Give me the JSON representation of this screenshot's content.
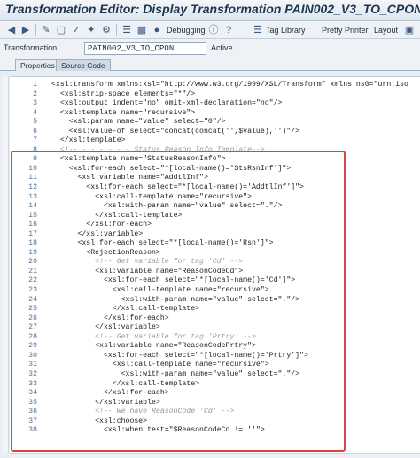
{
  "window": {
    "title": "Transformation Editor: Display Transformation PAIN002_V3_TO_CPON"
  },
  "toolbar": {
    "debugging_label": "Debugging",
    "tag_library_label": "Tag Library",
    "pretty_printer_label": "Pretty Printer",
    "layout_label": "Layout"
  },
  "transformation_field": {
    "label": "Transformation",
    "value": "PAIN002_V3_TO_CPON",
    "status": "Active"
  },
  "tabs": [
    {
      "label": "Properties",
      "active": false
    },
    {
      "label": "Source Code",
      "active": true
    }
  ],
  "editor": {
    "highlight_color": "#d64545",
    "lines": [
      {
        "no": "1",
        "text": "<xsl:transform xmlns:xsl=\"http://www.w3.org/1999/XSL/Transform\" xmlns:ns0=\"urn:iso",
        "comment": false
      },
      {
        "no": "2",
        "text": "  <xsl:strip-space elements=\"*\"/>",
        "comment": false
      },
      {
        "no": "3",
        "text": "  <xsl:output indent=\"no\" omit-xml-declaration=\"no\"/>",
        "comment": false
      },
      {
        "no": "4",
        "text": "  <xsl:template name=\"recursive\">",
        "comment": false
      },
      {
        "no": "5",
        "text": "    <xsl:param name=\"value\" select=\"0\"/>",
        "comment": false
      },
      {
        "no": "6",
        "text": "    <xsl:value-of select=\"concat(concat('',$value),'')\"/>",
        "comment": false
      },
      {
        "no": "7",
        "text": "  </xsl:template>",
        "comment": false
      },
      {
        "no": "8",
        "text": "  <!-- - - - - - - Status Reason Info Template-->",
        "comment": true
      },
      {
        "no": "9",
        "text": "  <xsl:template name=\"StatusReasonInfo\">",
        "comment": false
      },
      {
        "no": "10",
        "text": "    <xsl:for-each select=\"*[local-name()='StsRsnInf']\">",
        "comment": false
      },
      {
        "no": "11",
        "text": "      <xsl:variable name=\"AddtlInf\">",
        "comment": false
      },
      {
        "no": "12",
        "text": "        <xsl:for-each select=\"*[local-name()='AddtlInf']\">",
        "comment": false
      },
      {
        "no": "13",
        "text": "          <xsl:call-template name=\"recursive\">",
        "comment": false
      },
      {
        "no": "14",
        "text": "            <xsl:with-param name=\"value\" select=\".\"/>",
        "comment": false
      },
      {
        "no": "15",
        "text": "          </xsl:call-template>",
        "comment": false
      },
      {
        "no": "16",
        "text": "        </xsl:for-each>",
        "comment": false
      },
      {
        "no": "17",
        "text": "      </xsl:variable>",
        "comment": false
      },
      {
        "no": "18",
        "text": "      <xsl:for-each select=\"*[local-name()='Rsn']\">",
        "comment": false
      },
      {
        "no": "19",
        "text": "        <RejectionReason>",
        "comment": false
      },
      {
        "no": "20",
        "text": "          <!-- Get variable for tag 'Cd' -->",
        "comment": true
      },
      {
        "no": "21",
        "text": "          <xsl:variable name=\"ReasonCodeCd\">",
        "comment": false
      },
      {
        "no": "22",
        "text": "            <xsl:for-each select=\"*[local-name()='Cd']\">",
        "comment": false
      },
      {
        "no": "23",
        "text": "              <xsl:call-template name=\"recursive\">",
        "comment": false
      },
      {
        "no": "24",
        "text": "                <xsl:with-param name=\"value\" select=\".\"/>",
        "comment": false
      },
      {
        "no": "25",
        "text": "              </xsl:call-template>",
        "comment": false
      },
      {
        "no": "26",
        "text": "            </xsl:for-each>",
        "comment": false
      },
      {
        "no": "27",
        "text": "          </xsl:variable>",
        "comment": false
      },
      {
        "no": "28",
        "text": "          <!-- Get variable for tag 'Prtry' -->",
        "comment": true
      },
      {
        "no": "29",
        "text": "          <xsl:variable name=\"ReasonCodePrtry\">",
        "comment": false
      },
      {
        "no": "30",
        "text": "            <xsl:for-each select=\"*[local-name()='Prtry']\">",
        "comment": false
      },
      {
        "no": "31",
        "text": "              <xsl:call-template name=\"recursive\">",
        "comment": false
      },
      {
        "no": "32",
        "text": "                <xsl:with-param name=\"value\" select=\".\"/>",
        "comment": false
      },
      {
        "no": "33",
        "text": "              </xsl:call-template>",
        "comment": false
      },
      {
        "no": "34",
        "text": "            </xsl:for-each>",
        "comment": false
      },
      {
        "no": "35",
        "text": "          </xsl:variable>",
        "comment": false
      },
      {
        "no": "36",
        "text": "          <!-- We have ReasonCode 'Cd' -->",
        "comment": true
      },
      {
        "no": "37",
        "text": "          <xsl:choose>",
        "comment": false
      },
      {
        "no": "38",
        "text": "            <xsl:when test=\"$ReasonCodeCd != ''\">",
        "comment": false
      }
    ]
  }
}
